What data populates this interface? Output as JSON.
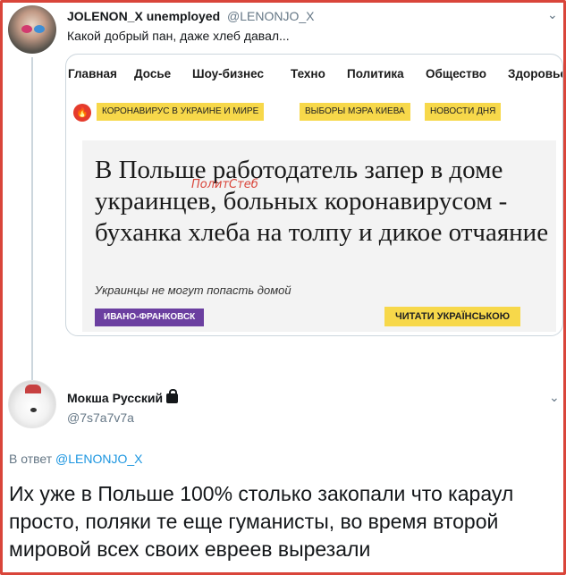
{
  "tweet1": {
    "name": "JOLENON_X unemployed",
    "handle": "@LENONJO_X",
    "text": "Какой добрый пан, даже хлеб давал...",
    "caret": "⌄"
  },
  "card": {
    "nav": [
      "Главная",
      "Досье",
      "Шоу-бизнес",
      "Техно",
      "Политика",
      "Общество",
      "Здоровье"
    ],
    "tags": [
      "КОРОНАВИРУС В УКРАИНЕ И МИРЕ",
      "ВЫБОРЫ МЭРА КИЕВА",
      "НОВОСТИ ДНЯ"
    ],
    "headline": "В Польше работодатель запер в доме украинцев, больных коронавирусом - буханка хлеба на толпу и дикое отчаяние",
    "watermark": "ПолитСтеб",
    "subtitle": "Украинцы не могут попасть домой",
    "region": "ИВАНО-ФРАНКОВСК",
    "read_button": "ЧИТАТИ УКРАЇНСЬКОЮ"
  },
  "tweet2": {
    "name": "Мокша Русский",
    "handle": "@7s7a7v7a",
    "caret": "⌄",
    "reply_prefix": "В ответ",
    "reply_mention": "@LENONJO_X",
    "text": "Их уже в Польше 100% столько закопали что караул просто, поляки те еще гуманисты, во время второй мировой всех своих евреев вырезали"
  },
  "colors": {
    "frame": "#d9453a",
    "tag_yellow": "#f7d84a",
    "region_purple": "#6b3fa0",
    "mention_blue": "#1b95e0"
  }
}
